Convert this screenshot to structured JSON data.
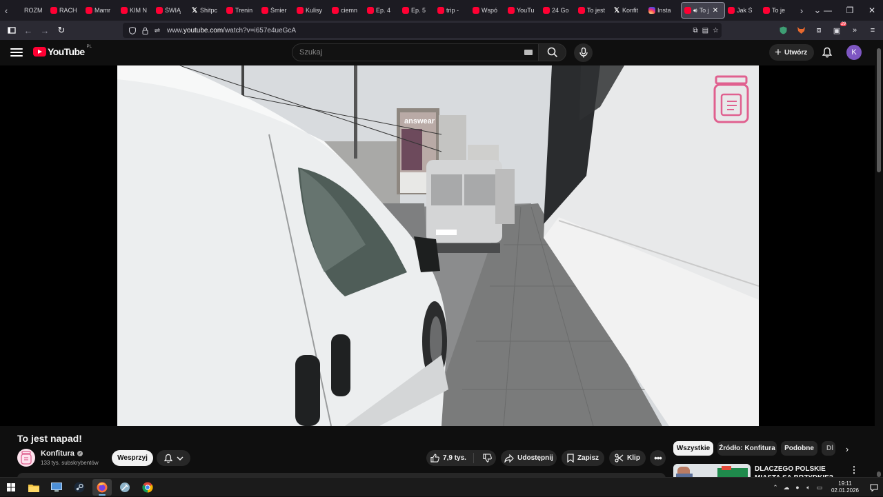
{
  "browser": {
    "tabs": [
      {
        "favicon": "generic-icon",
        "label": "ROZM"
      },
      {
        "favicon": "youtube-icon",
        "label": "RACH"
      },
      {
        "favicon": "youtube-icon",
        "label": "Mamr"
      },
      {
        "favicon": "youtube-icon",
        "label": "KIM N"
      },
      {
        "favicon": "youtube-icon",
        "label": "ŚWIĄ"
      },
      {
        "favicon": "x-icon",
        "label": "Shitpc"
      },
      {
        "favicon": "youtube-icon",
        "label": "Trenin"
      },
      {
        "favicon": "youtube-icon",
        "label": "Śmier"
      },
      {
        "favicon": "youtube-icon",
        "label": "Kulisy"
      },
      {
        "favicon": "youtube-icon",
        "label": "ciemn"
      },
      {
        "favicon": "youtube-icon",
        "label": "Ep. 4"
      },
      {
        "favicon": "youtube-icon",
        "label": "Ep. 5"
      },
      {
        "favicon": "youtube-icon",
        "label": "trip -"
      },
      {
        "favicon": "youtube-icon",
        "label": "Wspó"
      },
      {
        "favicon": "youtube-icon",
        "label": "YouTu"
      },
      {
        "favicon": "youtube-icon",
        "label": "24 Go"
      },
      {
        "favicon": "youtube-icon",
        "label": "To jest"
      },
      {
        "favicon": "x-icon",
        "label": "Konfit"
      },
      {
        "favicon": "instagram-icon",
        "label": "Insta"
      }
    ],
    "active_tab": {
      "favicon": "youtube-icon",
      "label": "To j"
    },
    "tabs_after": [
      {
        "favicon": "youtube-icon",
        "label": "Jak Ś"
      },
      {
        "favicon": "youtube-icon",
        "label": "To je"
      }
    ],
    "url_prefix": "www.",
    "url_domain": "youtube.com",
    "url_path": "/watch?v=i657e4ueGcA",
    "extension_badge": "29"
  },
  "youtube": {
    "logo_text": "YouTube",
    "region": "PL",
    "search_placeholder": "Szukaj",
    "create_label": "Utwórz",
    "avatar_letter": "K"
  },
  "video": {
    "title": "To jest napad!",
    "channel_name": "Konfitura",
    "subscribers": "133 tys. subskrybentów",
    "support_label": "Wesprzyj",
    "likes": "7,9 tys.",
    "share_label": "Udostępnij",
    "save_label": "Zapisz",
    "clip_label": "Klip",
    "billboard_text": "answear"
  },
  "chips": [
    "Wszystkie",
    "Źródło: Konfitura",
    "Podobne",
    "Dl"
  ],
  "recommendation": {
    "title": "DLACZEGO POLSKIE MIASTA SĄ BRZYDKIE?"
  },
  "taskbar": {
    "time": "19:11",
    "date": "02.01.2026"
  },
  "colors": {
    "yt_red": "#ff0033",
    "background": "#0f0f0f",
    "chip_active": "#f1f1f1",
    "avatar": "#7e57c2"
  }
}
